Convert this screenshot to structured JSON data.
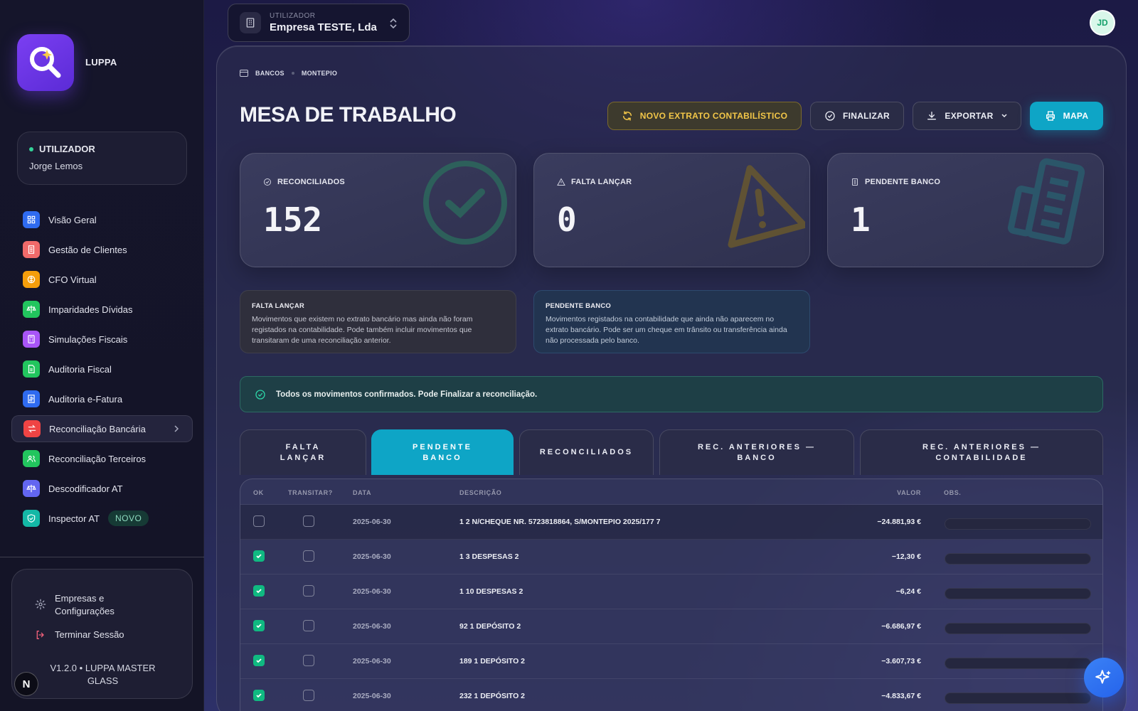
{
  "app": {
    "name": "LUPPA",
    "version": "V1.2.0 • LUPPA MASTER GLASS",
    "colors": {
      "accent": "#0ea5c6",
      "brand": "#7b3ff2",
      "success": "#10b981",
      "warning": "#f2c648"
    }
  },
  "sidebar": {
    "user_label": "UTILIZADOR",
    "user_name": "Jorge Lemos",
    "items": [
      {
        "label": "Visão Geral",
        "icon": "grid-icon",
        "color": "#2f6bf0"
      },
      {
        "label": "Gestão de Clientes",
        "icon": "building-icon",
        "color": "#f06a6a"
      },
      {
        "label": "CFO Virtual",
        "icon": "brain-icon",
        "color": "#f59e0b"
      },
      {
        "label": "Imparidades Dívidas",
        "icon": "scale-icon",
        "color": "#22c55e"
      },
      {
        "label": "Simulações Fiscais",
        "icon": "calculator-icon",
        "color": "#a855f7"
      },
      {
        "label": "Auditoria Fiscal",
        "icon": "document-icon",
        "color": "#22c55e"
      },
      {
        "label": "Auditoria e-Fatura",
        "icon": "receipt-icon",
        "color": "#2f6bf0"
      },
      {
        "label": "Reconciliação Bancária",
        "icon": "arrows-icon",
        "color": "#ef4444"
      },
      {
        "label": "Reconciliação Terceiros",
        "icon": "users-icon",
        "color": "#22c55e"
      },
      {
        "label": "Descodificador AT",
        "icon": "scale-icon",
        "color": "#6366f1"
      },
      {
        "label": "Inspector AT",
        "icon": "shield-icon",
        "color": "#14b8a6",
        "badge": "NOVO"
      }
    ],
    "settings_label": "Empresas e Configurações",
    "settings_line1": "Empresas e",
    "settings_line2": "Configurações",
    "logout_label": "Terminar Sessão",
    "n_button": "N"
  },
  "topbar": {
    "selector_label": "UTILIZADOR",
    "selector_value": "Empresa TESTE, Lda",
    "avatar": "JD"
  },
  "main": {
    "breadcrumb": [
      "BANCOS",
      "MONTEPIO"
    ],
    "title": "MESA DE TRABALHO",
    "buttons": {
      "novo": "NOVO EXTRATO CONTABILÍSTICO",
      "finalizar": "FINALIZAR",
      "exportar": "EXPORTAR",
      "mapa": "MAPA"
    },
    "stats": [
      {
        "label": "RECONCILIADOS",
        "value": "152",
        "icon": "check-circle-icon"
      },
      {
        "label": "FALTA LANÇAR",
        "value": "0",
        "icon": "warning-icon"
      },
      {
        "label": "PENDENTE BANCO",
        "value": "1",
        "icon": "building-icon"
      }
    ],
    "notes": [
      {
        "title": "FALTA LANÇAR",
        "text": "Movimentos que existem no extrato bancário mas ainda não foram registados na contabilidade. Pode também incluir movimentos que transitaram de uma reconciliação anterior."
      },
      {
        "title": "PENDENTE BANCO",
        "text": "Movimentos registados na contabilidade que ainda não aparecem no extrato bancário. Pode ser um cheque em trânsito ou transferência ainda não processada pelo banco."
      }
    ],
    "alert": "Todos os movimentos confirmados. Pode Finalizar a reconciliação.",
    "tabs": [
      {
        "line1": "FALTA",
        "line2": "LANÇAR"
      },
      {
        "line1": "PENDENTE",
        "line2": "BANCO"
      },
      {
        "line1": "RECONCILIADOS",
        "line2": ""
      },
      {
        "line1": "REC. ANTERIORES —",
        "line2": "BANCO"
      },
      {
        "line1": "REC. ANTERIORES —",
        "line2": "CONTABILIDADE"
      }
    ],
    "active_tab": 1,
    "table": {
      "headers": {
        "ok": "OK",
        "transitar": "TRANSITAR?",
        "data": "DATA",
        "descricao": "DESCRIÇÃO",
        "valor": "VALOR",
        "obs": "OBS."
      },
      "rows": [
        {
          "ok": false,
          "transitar": false,
          "date": "2025-06-30",
          "desc": "1 2 N/CHEQUE NR. 5723818864, S/MONTEPIO 2025/177 7",
          "value": "−24.881,93 €"
        },
        {
          "ok": true,
          "transitar": false,
          "date": "2025-06-30",
          "desc": "1 3 DESPESAS 2",
          "value": "−12,30 €"
        },
        {
          "ok": true,
          "transitar": false,
          "date": "2025-06-30",
          "desc": "1 10 DESPESAS 2",
          "value": "−6,24 €"
        },
        {
          "ok": true,
          "transitar": false,
          "date": "2025-06-30",
          "desc": "92 1 DEPÓSITO 2",
          "value": "−6.686,97 €"
        },
        {
          "ok": true,
          "transitar": false,
          "date": "2025-06-30",
          "desc": "189 1 DEPÓSITO 2",
          "value": "−3.607,73 €"
        },
        {
          "ok": true,
          "transitar": false,
          "date": "2025-06-30",
          "desc": "232 1 DEPÓSITO 2",
          "value": "−4.833,67 €"
        }
      ]
    }
  }
}
